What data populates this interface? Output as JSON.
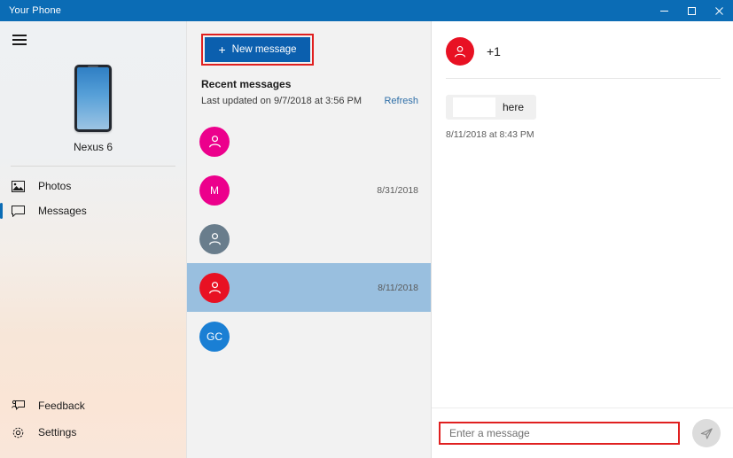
{
  "window": {
    "title": "Your Phone",
    "controls": [
      {
        "name": "minimize",
        "glyph": "minimize-icon"
      },
      {
        "name": "maximize",
        "glyph": "maximize-icon"
      },
      {
        "name": "close",
        "glyph": "close-icon"
      }
    ]
  },
  "sidebar": {
    "menu_icon": "hamburger-icon",
    "device": {
      "icon": "phone-icon",
      "name": "Nexus 6"
    },
    "items": [
      {
        "label": "Photos",
        "icon": "photos-icon",
        "selected": false
      },
      {
        "label": "Messages",
        "icon": "message-icon",
        "selected": true
      }
    ],
    "bottom_items": [
      {
        "label": "Feedback",
        "icon": "feedback-icon"
      },
      {
        "label": "Settings",
        "icon": "gear-icon"
      }
    ]
  },
  "message_list": {
    "new_message_label": "New message",
    "new_message_plus": "+",
    "recent_title": "Recent messages",
    "last_updated": "Last updated on 9/7/2018 at 3:56 PM",
    "refresh_label": "Refresh",
    "conversations": [
      {
        "initials": "",
        "icon": "person-icon",
        "color": "#ec008c",
        "date": "",
        "selected": false
      },
      {
        "initials": "M",
        "icon": "",
        "color": "#ec008c",
        "date": "8/31/2018",
        "selected": false
      },
      {
        "initials": "",
        "icon": "person-icon",
        "color": "#697d8c",
        "date": "",
        "selected": false
      },
      {
        "initials": "",
        "icon": "person-icon",
        "color": "#e81123",
        "date": "8/11/2018",
        "selected": true
      },
      {
        "initials": "GC",
        "icon": "",
        "color": "#1a7fd4",
        "date": "",
        "selected": false
      }
    ]
  },
  "conversation": {
    "header": {
      "avatar_color": "#e81123",
      "avatar_icon": "person-icon",
      "name": "+1"
    },
    "messages": [
      {
        "redacted": true,
        "text": "here",
        "timestamp": "8/11/2018 at 8:43 PM"
      }
    ],
    "composer": {
      "placeholder": "Enter a message",
      "value": "",
      "send_icon": "send-icon"
    }
  },
  "colors": {
    "titlebar": "#0b6cb5",
    "accent_button": "#0b5fae",
    "annotation": "#e02020",
    "selected_row": "#99bfdf",
    "link": "#2f6fa8"
  }
}
